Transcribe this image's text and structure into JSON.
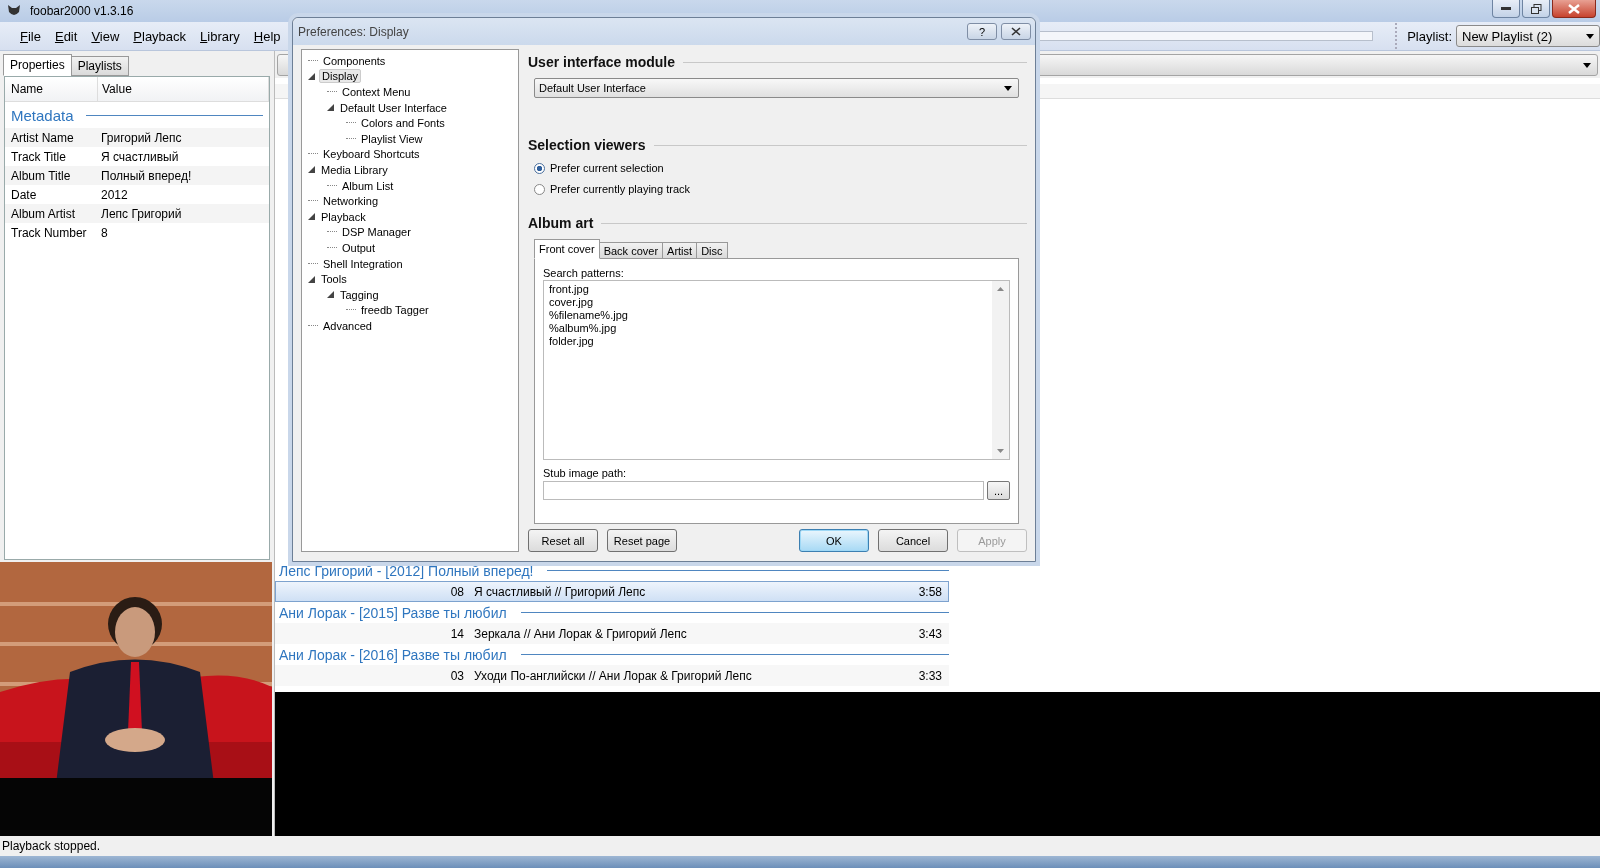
{
  "window": {
    "title": "foobar2000 v1.3.16"
  },
  "menu": [
    "File",
    "Edit",
    "View",
    "Playback",
    "Library",
    "Help"
  ],
  "toolbar": {
    "playlist_label": "Playlist:",
    "playlist_value": "New Playlist (2)"
  },
  "left_panel": {
    "tabs": [
      {
        "label": "Properties",
        "selected": true
      },
      {
        "label": "Playlists",
        "selected": false
      }
    ],
    "columns": [
      "Name",
      "Value"
    ],
    "group": "Metadata",
    "rows": [
      {
        "name": "Artist Name",
        "value": "Григорий Лепс"
      },
      {
        "name": "Track Title",
        "value": "Я счастливый"
      },
      {
        "name": "Album Title",
        "value": "Полный вперед!"
      },
      {
        "name": "Date",
        "value": "2012"
      },
      {
        "name": "Album Artist",
        "value": "Лепс Григорий"
      },
      {
        "name": "Track Number",
        "value": "8"
      }
    ]
  },
  "playlist": {
    "groups": [
      {
        "header": "Лепс Григорий - [2012] Полный вперед!",
        "tracks": [
          {
            "number": "08",
            "title": "Я счастливый // Григорий Лепс",
            "duration": "3:58",
            "selected": true
          }
        ]
      },
      {
        "header": "Ани Лорак - [2015] Разве ты любил",
        "tracks": [
          {
            "number": "14",
            "title": "Зеркала // Ани Лорак & Григорий Лепс",
            "duration": "3:43",
            "selected": false
          }
        ]
      },
      {
        "header": "Ани Лорак - [2016] Разве ты любил",
        "tracks": [
          {
            "number": "03",
            "title": "Уходи По-английски // Ани Лорак & Григорий Лепс",
            "duration": "3:33",
            "selected": false
          }
        ]
      }
    ]
  },
  "status_bar": "Playback stopped.",
  "dialog": {
    "title": "Preferences: Display",
    "help": "?",
    "tree": [
      {
        "label": "Components",
        "selected": false
      },
      {
        "label": "Display",
        "selected": true,
        "expanded": true,
        "children": [
          {
            "label": "Context Menu",
            "selected": false
          },
          {
            "label": "Default User Interface",
            "selected": false,
            "expanded": true,
            "children": [
              {
                "label": "Colors and Fonts",
                "selected": false
              },
              {
                "label": "Playlist View",
                "selected": false
              }
            ]
          }
        ]
      },
      {
        "label": "Keyboard Shortcuts",
        "selected": false
      },
      {
        "label": "Media Library",
        "selected": false,
        "expanded": true,
        "children": [
          {
            "label": "Album List",
            "selected": false
          }
        ]
      },
      {
        "label": "Networking",
        "selected": false
      },
      {
        "label": "Playback",
        "selected": false,
        "expanded": true,
        "children": [
          {
            "label": "DSP Manager",
            "selected": false
          },
          {
            "label": "Output",
            "selected": false
          }
        ]
      },
      {
        "label": "Shell Integration",
        "selected": false
      },
      {
        "label": "Tools",
        "selected": false,
        "expanded": true,
        "children": [
          {
            "label": "Tagging",
            "selected": false,
            "expanded": true,
            "children": [
              {
                "label": "freedb Tagger",
                "selected": false
              }
            ]
          }
        ]
      },
      {
        "label": "Advanced",
        "selected": false
      }
    ],
    "ui_module": {
      "heading": "User interface module",
      "value": "Default User Interface"
    },
    "selection_viewers": {
      "heading": "Selection viewers",
      "options": [
        {
          "label": "Prefer current selection",
          "selected": true
        },
        {
          "label": "Prefer currently playing track",
          "selected": false
        }
      ]
    },
    "album_art": {
      "heading": "Album art",
      "tabs": [
        {
          "label": "Front cover",
          "selected": true
        },
        {
          "label": "Back cover",
          "selected": false
        },
        {
          "label": "Artist",
          "selected": false
        },
        {
          "label": "Disc",
          "selected": false
        }
      ],
      "search_label": "Search patterns:",
      "patterns": [
        "front.jpg",
        "cover.jpg",
        "%filename%.jpg",
        "%album%.jpg",
        "folder.jpg"
      ],
      "stub_label": "Stub image path:",
      "browse": "..."
    },
    "buttons_left": [
      {
        "label": "Reset all",
        "default": false,
        "disabled": false
      },
      {
        "label": "Reset page",
        "default": false,
        "disabled": false
      }
    ],
    "buttons_right": [
      {
        "label": "OK",
        "default": true,
        "disabled": false
      },
      {
        "label": "Cancel",
        "default": false,
        "disabled": false
      },
      {
        "label": "Apply",
        "default": false,
        "disabled": true
      }
    ]
  }
}
